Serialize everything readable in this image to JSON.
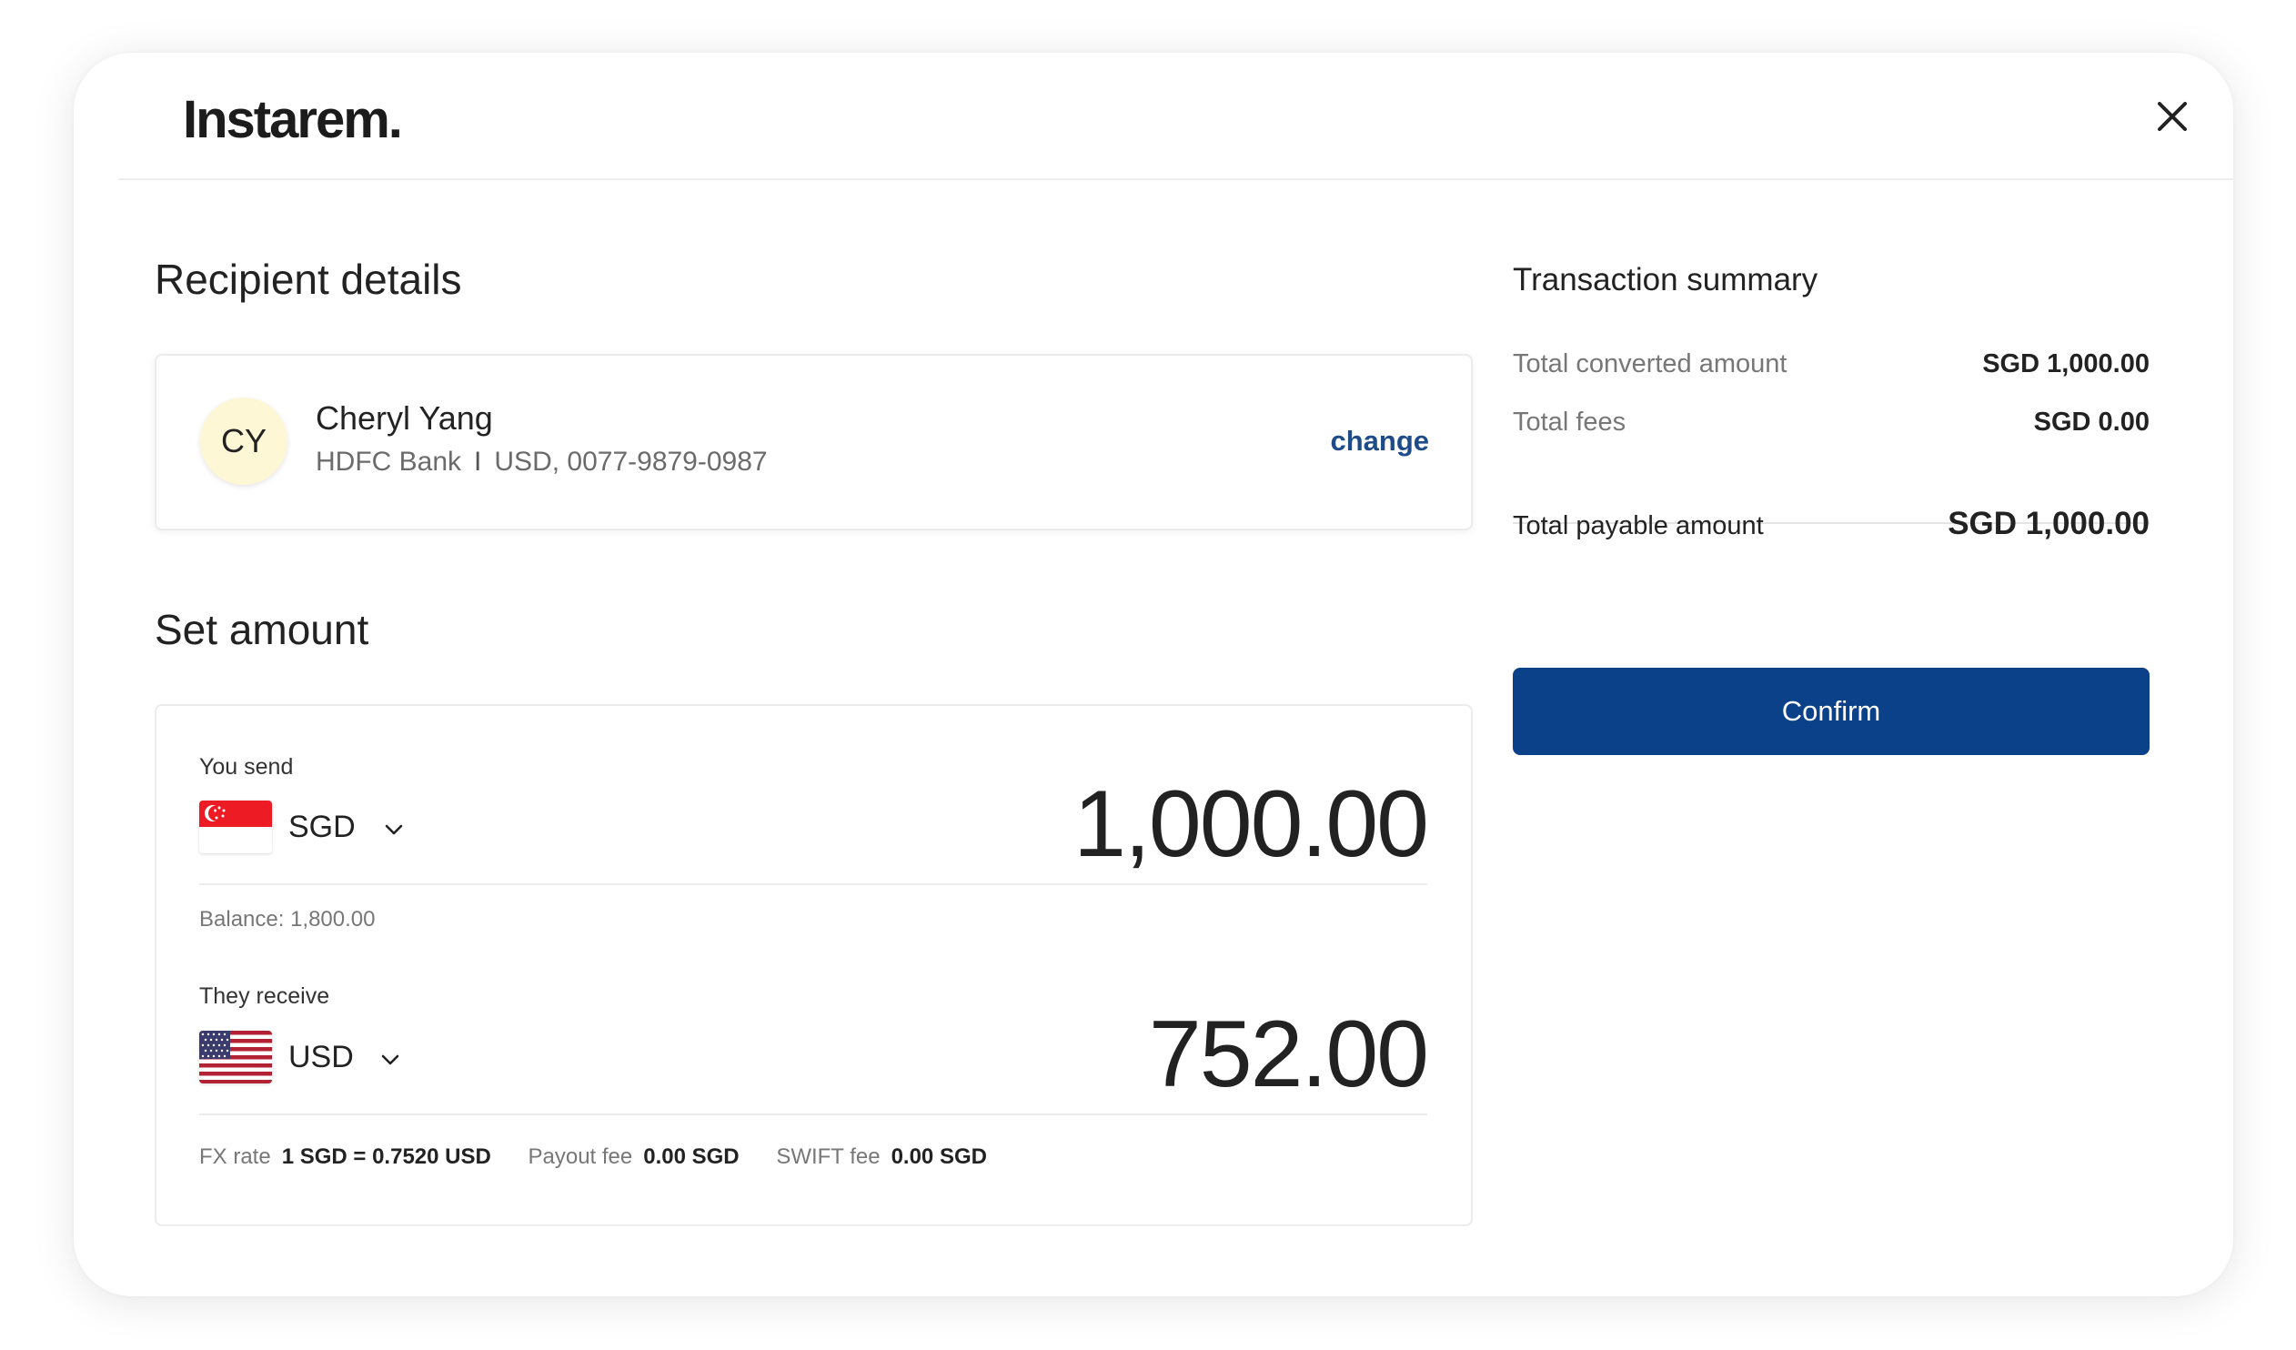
{
  "header": {
    "logo": "Instarem.",
    "close_icon": "close-icon"
  },
  "recipient": {
    "title": "Recipient details",
    "initials": "CY",
    "name": "Cheryl Yang",
    "bank": "HDFC Bank",
    "separator": "I",
    "account": "USD, 0077-9879-0987",
    "change_label": "change"
  },
  "amount": {
    "title": "Set amount",
    "send": {
      "label": "You send",
      "currency": "SGD",
      "flag_icon": "singapore-flag-icon",
      "value": "1,000.00",
      "balance": "Balance: 1,800.00"
    },
    "receive": {
      "label": "They receive",
      "currency": "USD",
      "flag_icon": "usa-flag-icon",
      "value": "752.00"
    },
    "fees": [
      {
        "label": "FX rate",
        "value": "1 SGD = 0.7520 USD"
      },
      {
        "label": "Payout fee",
        "value": "0.00 SGD"
      },
      {
        "label": "SWIFT fee",
        "value": "0.00 SGD"
      }
    ]
  },
  "summary": {
    "title": "Transaction summary",
    "rows": [
      {
        "label": "Total converted amount",
        "value": "SGD 1,000.00"
      },
      {
        "label": "Total fees",
        "value": "SGD 0.00"
      }
    ],
    "total": {
      "label": "Total payable amount",
      "value": "SGD 1,000.00"
    },
    "confirm_label": "Confirm"
  },
  "colors": {
    "accent": "#0b4188",
    "link": "#1e4b8a",
    "avatar_bg": "#fdf7d6"
  }
}
